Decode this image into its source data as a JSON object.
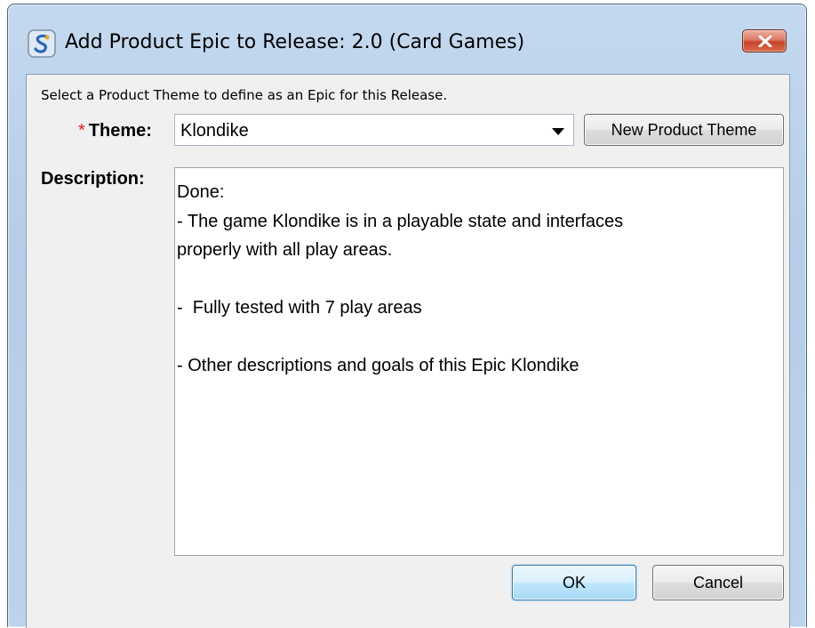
{
  "window": {
    "title": "Add Product Epic to Release: 2.0 (Card Games)",
    "app_icon": "product-app-icon",
    "close_icon": "close-icon"
  },
  "instruction": "Select a Product Theme to define as an Epic for this Release.",
  "theme": {
    "required_marker": "*",
    "label": "Theme:",
    "selected_value": "Klondike",
    "dropdown_icon": "chevron-down-icon"
  },
  "new_theme_button": "New Product Theme",
  "description": {
    "label": "Description:",
    "lines": [
      "Done:",
      "- The game Klondike is in a playable state and interfaces",
      "properly with all play areas.",
      "",
      "-  Fully tested with 7 play areas",
      "",
      "- Other descriptions and goals of this Epic Klondike"
    ]
  },
  "buttons": {
    "ok": "OK",
    "cancel": "Cancel"
  },
  "colors": {
    "required_star": "#e21b1b",
    "close_button": "#c6452a",
    "default_button_border": "#3c7fb1"
  }
}
